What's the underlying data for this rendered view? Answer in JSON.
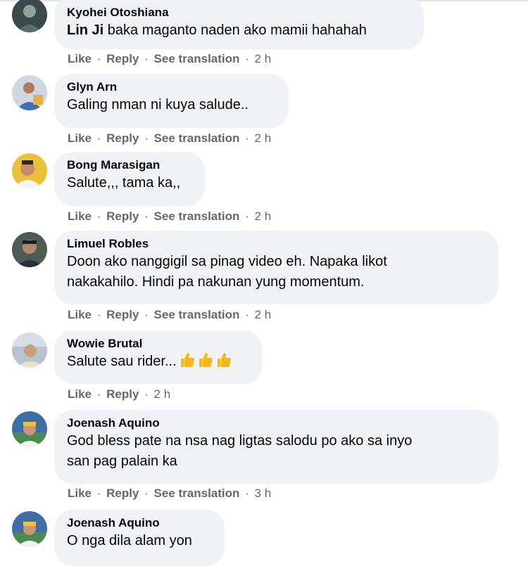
{
  "separator": " · ",
  "comments": [
    {
      "author": "Kyohei Otoshiana",
      "mention": "Lin Ji",
      "text": "baka maganto naden ako mamii hahahah",
      "actions": {
        "like": "Like",
        "reply": "Reply",
        "translate": "See translation",
        "time": "2 h"
      },
      "avatar_icon": "user-avatar-icon"
    },
    {
      "author": "Glyn Arn",
      "text": "Galing nman ni kuya salude..",
      "actions": {
        "like": "Like",
        "reply": "Reply",
        "translate": "See translation",
        "time": "2 h"
      },
      "avatar_icon": "user-avatar-icon"
    },
    {
      "author": "Bong Marasigan",
      "text": "Salute,,, tama ka,,",
      "actions": {
        "like": "Like",
        "reply": "Reply",
        "translate": "See translation",
        "time": "2 h"
      },
      "avatar_icon": "user-avatar-icon"
    },
    {
      "author": "Limuel Robles",
      "text_lines": [
        "Doon ako nanggigil sa pinag video eh. Napaka likot",
        "nakakahilo. Hindi pa nakunan yung momentum."
      ],
      "actions": {
        "like": "Like",
        "reply": "Reply",
        "translate": "See translation",
        "time": "2 h"
      },
      "avatar_icon": "user-avatar-icon"
    },
    {
      "author": "Wowie Brutal",
      "text": "Salute sau rider...",
      "emoji": [
        "thumbs-up-icon",
        "thumbs-up-icon",
        "thumbs-up-icon"
      ],
      "actions": {
        "like": "Like",
        "reply": "Reply",
        "time": "2 h"
      },
      "avatar_icon": "user-avatar-icon"
    },
    {
      "author": "Joenash Aquino",
      "text_lines": [
        "God bless pate na nsa nag ligtas salodu po ako sa inyo",
        "san pag palain ka"
      ],
      "actions": {
        "like": "Like",
        "reply": "Reply",
        "translate": "See translation",
        "time": "3 h"
      },
      "avatar_icon": "user-avatar-icon"
    },
    {
      "author": "Joenash Aquino",
      "text": "O nga dila alam yon",
      "avatar_icon": "user-avatar-icon"
    }
  ],
  "colors": {
    "bubble": "#f0f2f5",
    "secondary_text": "#65676b",
    "primary_text": "#050505",
    "emoji": "#f5b81b"
  }
}
